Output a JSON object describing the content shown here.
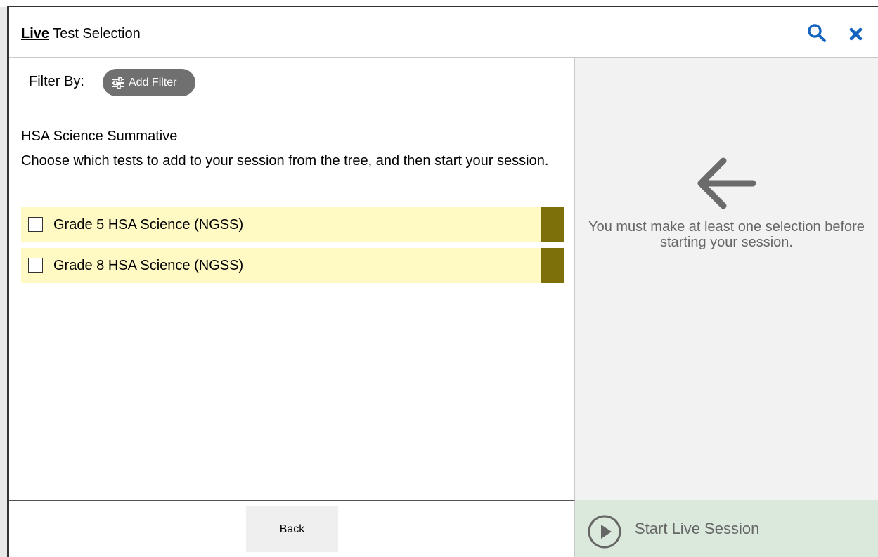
{
  "header": {
    "title_live": "Live",
    "title_rest": "Test Selection",
    "search_icon": "search-icon",
    "close_icon": "close-icon",
    "accent_color": "#1565c0"
  },
  "filter": {
    "label": "Filter By:",
    "add_filter_label": "Add Filter",
    "add_filter_icon": "sliders-icon"
  },
  "section": {
    "title": "HSA Science Summative",
    "instructions": "Choose which tests to add to your session from the tree, and then start your session."
  },
  "tests": [
    {
      "label": "Grade 5 HSA Science (NGSS)",
      "checked": false,
      "color": "#7d700a"
    },
    {
      "label": "Grade 8 HSA Science (NGSS)",
      "checked": false,
      "color": "#7d700a"
    }
  ],
  "side_panel": {
    "arrow_icon": "arrow-left-icon",
    "message": "You must make at least one selection before starting your session."
  },
  "footer": {
    "back_label": "Back",
    "start_label": "Start Live Session",
    "start_icon": "play-circle-icon"
  }
}
